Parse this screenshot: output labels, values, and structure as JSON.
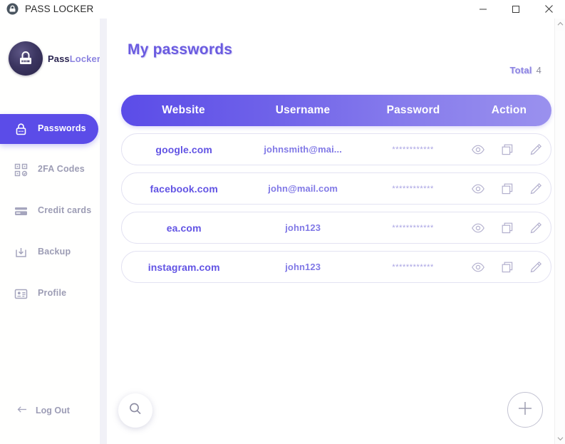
{
  "window": {
    "title": "PASS LOCKER",
    "icon": "app-lock-icon",
    "controls": {
      "minimize": "—",
      "maximize": "□",
      "close": "✕"
    }
  },
  "sidebar": {
    "logo": {
      "icon": "padlock-badge-icon",
      "name_first": "Pass",
      "name_second": "Locker"
    },
    "items": [
      {
        "label": "Passwords",
        "icon": "lock-icon",
        "active": true
      },
      {
        "label": "2FA Codes",
        "icon": "qr-code-icon",
        "active": false
      },
      {
        "label": "Credit cards",
        "icon": "credit-card-icon",
        "active": false
      },
      {
        "label": "Backup",
        "icon": "download-icon",
        "active": false
      },
      {
        "label": "Profile",
        "icon": "id-card-icon",
        "active": false
      }
    ],
    "logout": {
      "label": "Log Out",
      "icon": "arrow-left-icon"
    }
  },
  "main": {
    "title": "My passwords",
    "total": {
      "label": "Total",
      "value": "4"
    },
    "table": {
      "columns": [
        "Website",
        "Username",
        "Password",
        "Action"
      ],
      "rows": [
        {
          "website": "google.com",
          "username": "johnsmith@mai...",
          "password": "************",
          "actions": [
            "eye-icon",
            "copy-icon",
            "pencil-icon"
          ]
        },
        {
          "website": "facebook.com",
          "username": "john@mail.com",
          "password": "************",
          "actions": [
            "eye-icon",
            "copy-icon",
            "pencil-icon"
          ]
        },
        {
          "website": "ea.com",
          "username": "john123",
          "password": "************",
          "actions": [
            "eye-icon",
            "copy-icon",
            "pencil-icon"
          ]
        },
        {
          "website": "instagram.com",
          "username": "john123",
          "password": "************",
          "actions": [
            "eye-icon",
            "copy-icon",
            "pencil-icon"
          ]
        }
      ]
    },
    "search_button": {
      "icon": "search-icon"
    },
    "add_button": {
      "icon": "plus-icon"
    }
  },
  "colors": {
    "accent": "#5b4ce8",
    "accent_light": "#9a91ee",
    "site_text": "#6254e4",
    "user_text": "#8179e6",
    "muted": "#9c9cb4"
  }
}
